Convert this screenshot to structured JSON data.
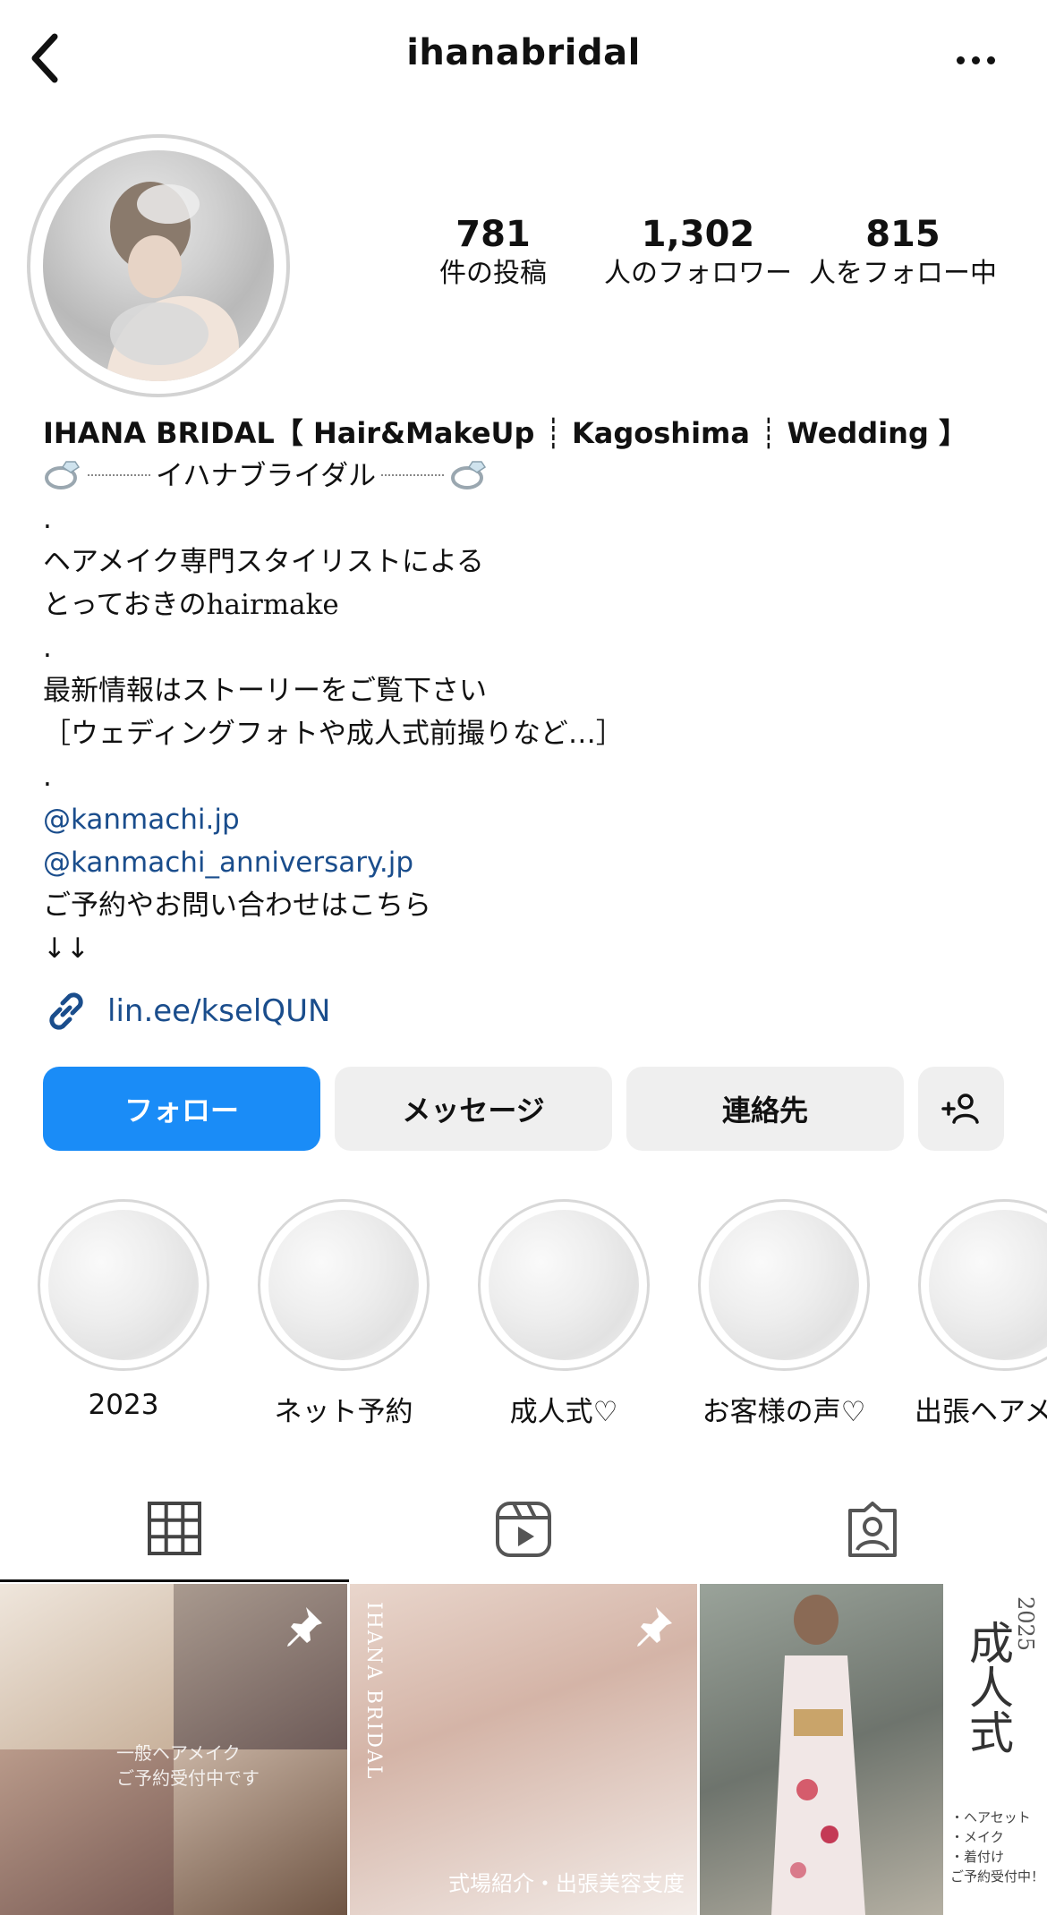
{
  "header": {
    "back_icon": "chevron-left-icon",
    "title": "ihanabridal",
    "more_icon": "more-horizontal-icon"
  },
  "stats": [
    {
      "value": "781",
      "label": "件の投稿"
    },
    {
      "value": "1,302",
      "label": "人のフォロワー"
    },
    {
      "value": "815",
      "label": "人をフォロー中"
    }
  ],
  "bio": {
    "name": "IHANA BRIDAL【 Hair&MakeUp ┊ Kagoshima ┊ Wedding 】",
    "tagline": "イハナブライダル",
    "dot": ".",
    "line1": "ヘアメイク専門スタイリストによる",
    "line2_prefix": "とっておきの",
    "line2_suffix": "hairmake",
    "line3": "最新情報はストーリーをご覧下さい",
    "line4": "［ウェディングフォトや成人式前撮りなど…］",
    "mention1": "@kanmachi.jp",
    "mention2": "@kanmachi_anniversary.jp",
    "line5": "ご予約やお問い合わせはこちら",
    "arrows": "↓↓"
  },
  "link": {
    "icon": "link-icon",
    "text": "lin.ee/kselQUN"
  },
  "buttons": {
    "follow": "フォロー",
    "message": "メッセージ",
    "contact": "連絡先",
    "add_icon": "add-person-icon"
  },
  "highlights": [
    "2023",
    "ネット予約",
    "成人式♡",
    "お客様の声♡",
    "出張ヘアメ"
  ],
  "tabs": [
    "grid-icon",
    "reels-icon",
    "tagged-icon"
  ],
  "posts": {
    "post1_overlay": [
      "一般ヘアメイク",
      "ご予約受付中です"
    ],
    "post2_vertical": "IHANA BRIDAL",
    "post2_caption": "式場紹介・出張美容支度",
    "post3_title": "成人式",
    "post3_year": "2025",
    "post3_menu": [
      "・ヘアセット",
      "・メイク",
      "・着付け",
      "ご予約受付中！"
    ]
  },
  "colors": {
    "follow_button": "#1a8cf7",
    "link": "#1a4d8c",
    "secondary_button": "#efefef"
  }
}
